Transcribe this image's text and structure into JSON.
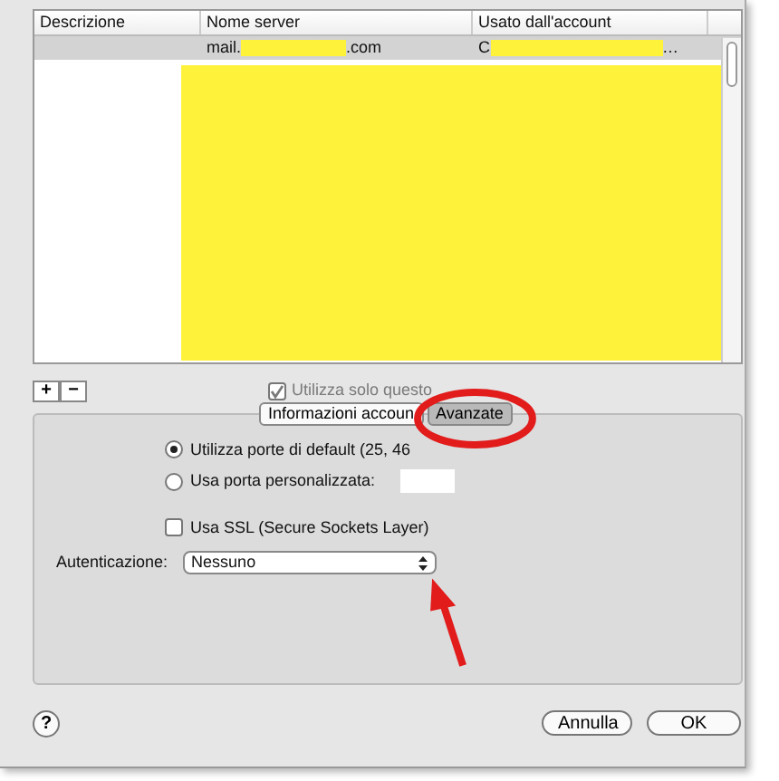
{
  "table": {
    "columns": [
      "Descrizione",
      "Nome server",
      "Usato dall'account"
    ],
    "rows": [
      {
        "server_before": "mail.",
        "server_after": ".com",
        "account_before": "C",
        "account_after": "…",
        "selected": true
      }
    ]
  },
  "list_buttons": [
    "+",
    "−"
  ],
  "use_only_server": {
    "label": "Utilizza solo questo",
    "checked": true,
    "disabled": true
  },
  "tabs": [
    {
      "label": "Informazioni accoun",
      "selected": false
    },
    {
      "label": "Avanzate",
      "selected": true
    }
  ],
  "ports": [
    {
      "label": "Utilizza porte di default (25, 46",
      "selected": true
    },
    {
      "label": "Usa porta personalizzata:",
      "selected": false
    }
  ],
  "ssl": {
    "label": "Usa SSL (Secure Sockets Layer)",
    "checked": false
  },
  "auth": {
    "label": "Autenticazione:",
    "value": "Nessuno"
  },
  "help": "?",
  "buttons": [
    {
      "label": "Annulla",
      "default": false
    },
    {
      "label": "OK",
      "default": false
    }
  ]
}
